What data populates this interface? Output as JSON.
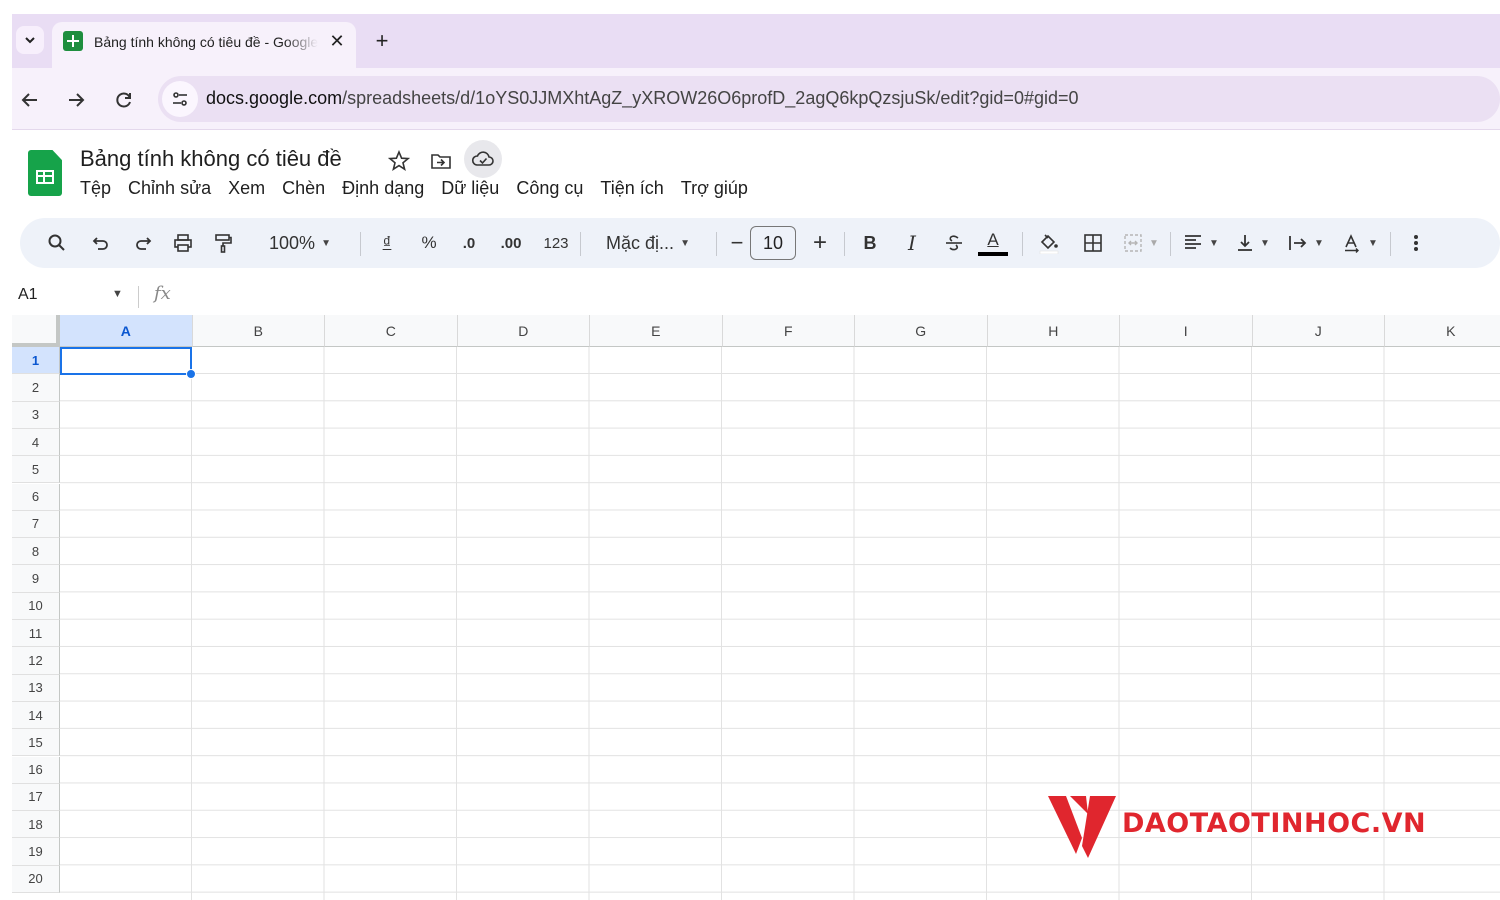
{
  "browser": {
    "tab_title": "Bảng tính không có tiêu đề - Google Trang tính",
    "url_host": "docs.google.com",
    "url_path": "/spreadsheets/d/1oYS0JJMXhtAgZ_yXROW26O6profD_2agQ6kpQzsjuSk/edit?gid=0#gid=0"
  },
  "app": {
    "doc_title": "Bảng tính không có tiêu đề",
    "menu": [
      "Tệp",
      "Chỉnh sửa",
      "Xem",
      "Chèn",
      "Định dạng",
      "Dữ liệu",
      "Công cụ",
      "Tiện ích",
      "Trợ giúp"
    ]
  },
  "toolbar": {
    "zoom": "100%",
    "currency": "₫",
    "percent": "%",
    "decrease_decimal": ".0",
    "increase_decimal": ".00",
    "number_format": "123",
    "font": "Mặc đị...",
    "minus": "−",
    "font_size": "10",
    "plus": "+",
    "bold": "B",
    "italic": "I",
    "text_color_letter": "A"
  },
  "formula_bar": {
    "name_box": "A1",
    "fx": "fx",
    "value": ""
  },
  "grid": {
    "columns": [
      "A",
      "B",
      "C",
      "D",
      "E",
      "F",
      "G",
      "H",
      "I",
      "J",
      "K"
    ],
    "rows": [
      "1",
      "2",
      "3",
      "4",
      "5",
      "6",
      "7",
      "8",
      "9",
      "10",
      "11",
      "12",
      "13",
      "14",
      "15",
      "16",
      "17",
      "18",
      "19",
      "20"
    ],
    "selected_cell": "A1"
  },
  "watermark": {
    "text": "DAOTAOTINHOC.VN"
  },
  "colors": {
    "tabstrip_bg": "#e9ddf4",
    "sheets_green": "#16a34a",
    "selection_blue": "#1a73e8",
    "watermark_red": "#e0262e"
  }
}
